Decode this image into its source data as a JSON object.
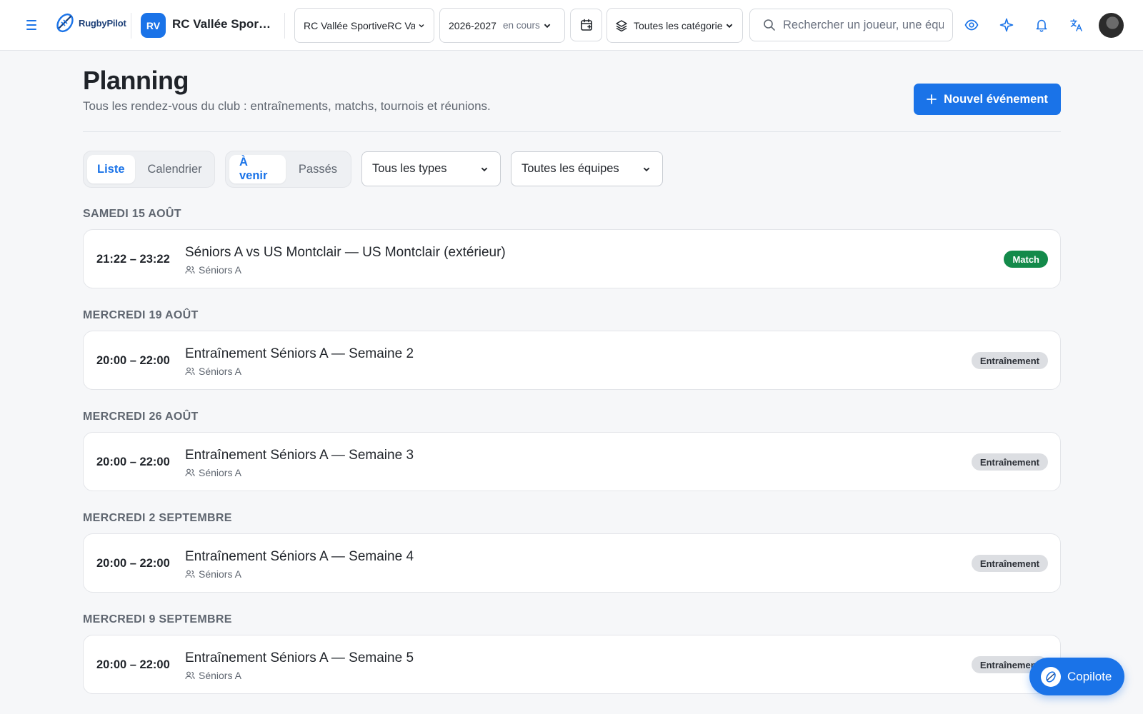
{
  "topbar": {
    "brand": "RugbyPilot",
    "club_initials": "RV",
    "club_name": "RC Vallée Sportive",
    "club_select": "RC Vallée SportiveRC Vallée Sportive",
    "season_select": "2026-2027",
    "season_status": "en cours",
    "category_select": "Toutes les catégories",
    "search_placeholder": "Rechercher un joueur, une équipe…",
    "icons": [
      "menu-icon",
      "calendar-add-icon",
      "layers-icon",
      "search-icon",
      "eye-icon",
      "sparkle-icon",
      "bell-icon",
      "translate-icon"
    ]
  },
  "header": {
    "title": "Planning",
    "subtitle": "Tous les rendez-vous du club : entraînements, matchs, tournois et réunions.",
    "new_event_label": "Nouvel événement"
  },
  "filters": {
    "view_tabs": [
      {
        "label": "Liste",
        "active": true
      },
      {
        "label": "Calendrier",
        "active": false
      }
    ],
    "time_tabs": [
      {
        "label": "À venir",
        "active": true
      },
      {
        "label": "Passés",
        "active": false
      }
    ],
    "type_select": "Tous les types",
    "team_select": "Toutes les équipes"
  },
  "days": [
    {
      "label": "SAMEDI 15 AOÛT",
      "event": {
        "time": "21:22 – 23:22",
        "title": "Séniors A vs US Montclair — US Montclair (extérieur)",
        "team": "Séniors A",
        "badge": "Match",
        "badge_kind": "match"
      }
    },
    {
      "label": "MERCREDI 19 AOÛT",
      "event": {
        "time": "20:00 – 22:00",
        "title": "Entraînement Séniors A — Semaine 2",
        "team": "Séniors A",
        "badge": "Entraînement",
        "badge_kind": "training"
      }
    },
    {
      "label": "MERCREDI 26 AOÛT",
      "event": {
        "time": "20:00 – 22:00",
        "title": "Entraînement Séniors A — Semaine 3",
        "team": "Séniors A",
        "badge": "Entraînement",
        "badge_kind": "training"
      }
    },
    {
      "label": "MERCREDI 2 SEPTEMBRE",
      "event": {
        "time": "20:00 – 22:00",
        "title": "Entraînement Séniors A — Semaine 4",
        "team": "Séniors A",
        "badge": "Entraînement",
        "badge_kind": "training"
      }
    },
    {
      "label": "MERCREDI 9 SEPTEMBRE",
      "event": {
        "time": "20:00 – 22:00",
        "title": "Entraînement Séniors A — Semaine 5",
        "team": "Séniors A",
        "badge": "Entraînement",
        "badge_kind": "training"
      }
    }
  ],
  "copilot": {
    "label": "Copilote"
  },
  "colors": {
    "accent": "#1a73e8",
    "match": "#138a4a",
    "training": "#dcdee2"
  }
}
